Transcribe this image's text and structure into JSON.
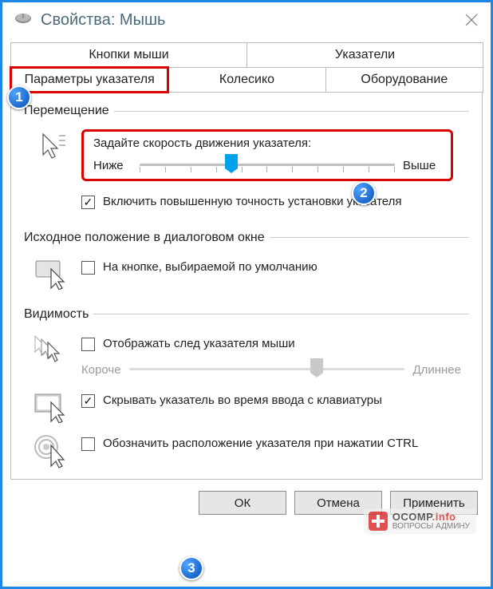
{
  "window": {
    "title": "Свойства: Мышь"
  },
  "tabs": {
    "row1": [
      {
        "label": "Кнопки мыши"
      },
      {
        "label": "Указатели"
      }
    ],
    "row2": [
      {
        "label": "Параметры указателя"
      },
      {
        "label": "Колесико"
      },
      {
        "label": "Оборудование"
      }
    ],
    "selected": "Параметры указателя"
  },
  "groups": {
    "motion": {
      "legend": "Перемещение",
      "prompt": "Задайте скорость движения указателя:",
      "slow": "Ниже",
      "fast": "Выше",
      "slider_pos_pct": 36,
      "enhance": {
        "checked": true,
        "label": "Включить повышенную точность установки указателя"
      }
    },
    "snapto": {
      "legend": "Исходное положение в диалоговом окне",
      "default_btn": {
        "checked": false,
        "label": "На кнопке, выбираемой по умолчанию"
      }
    },
    "visibility": {
      "legend": "Видимость",
      "trails": {
        "checked": false,
        "label": "Отображать след указателя мыши"
      },
      "trails_short": "Короче",
      "trails_long": "Длиннее",
      "trails_pos_pct": 68,
      "hide_typing": {
        "checked": true,
        "label": "Скрывать указатель во время ввода с клавиатуры"
      },
      "ctrl_locate": {
        "checked": false,
        "label": "Обозначить расположение указателя при нажатии CTRL"
      }
    }
  },
  "buttons": {
    "ok": "ОК",
    "cancel": "Отмена",
    "apply": "Применить"
  },
  "annotations": {
    "c1": "1",
    "c2": "2",
    "c3": "3"
  },
  "watermark": {
    "brand": "OCOMP",
    "tld": ".info",
    "subtitle": "ВОПРОСЫ АДМИНУ"
  }
}
